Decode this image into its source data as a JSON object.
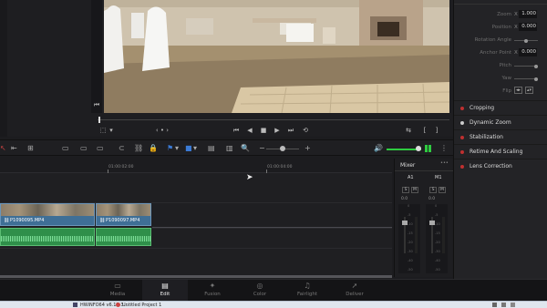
{
  "inspector": {
    "zoom": {
      "label": "Zoom",
      "axis": "X",
      "value": "1.000"
    },
    "position": {
      "label": "Position",
      "axis": "X",
      "value": "0.000"
    },
    "rotation": {
      "label": "Rotation Angle"
    },
    "anchor": {
      "label": "Anchor Point",
      "axis": "X",
      "value": "0.000"
    },
    "pitch": {
      "label": "Pitch"
    },
    "yaw": {
      "label": "Yaw"
    },
    "flip": {
      "label": "Flip"
    },
    "sections": [
      {
        "label": "Cropping"
      },
      {
        "label": "Dynamic Zoom"
      },
      {
        "label": "Stabilization"
      },
      {
        "label": "Retime And Scaling"
      },
      {
        "label": "Lens Correction"
      }
    ]
  },
  "timeline": {
    "timecodes": [
      "01:00:02:00",
      "01:00:04:00"
    ],
    "video_clips": [
      {
        "name": "P1090095.MP4"
      },
      {
        "name": "P1090097.MP4"
      }
    ]
  },
  "mixer": {
    "title": "Mixer",
    "channels": [
      {
        "name": "A1",
        "solo": "S",
        "mute": "M",
        "value": "0.0"
      },
      {
        "name": "M1",
        "solo": "S",
        "mute": "M",
        "value": "0.0"
      }
    ],
    "scale": [
      "0",
      "-5",
      "-10",
      "-15",
      "-20",
      "-30",
      "-40",
      "-50"
    ]
  },
  "pages": [
    {
      "label": "Media"
    },
    {
      "label": "Edit"
    },
    {
      "label": "Fusion"
    },
    {
      "label": "Color"
    },
    {
      "label": "Fairlight"
    },
    {
      "label": "Deliver"
    }
  ],
  "taskbar": {
    "items": [
      {
        "label": "HWiNFO64 v6.12-3..."
      },
      {
        "label": "Untitled Project 1"
      }
    ]
  },
  "colors": {
    "accent": "#c04040",
    "video_clip": "#3f6f96",
    "audio_clip": "#2f8f4a",
    "level_meter": "#2ecc40"
  }
}
